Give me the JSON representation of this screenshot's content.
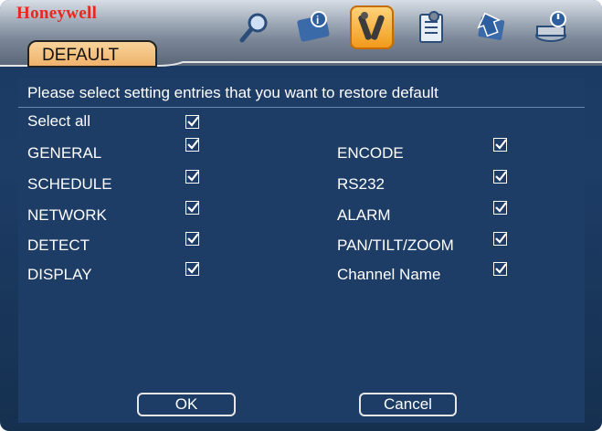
{
  "header": {
    "brand": "Honeywell",
    "tab_label": "DEFAULT",
    "icons": [
      {
        "name": "search-icon",
        "active": false,
        "glyph": "🔍"
      },
      {
        "name": "info-icon",
        "active": false,
        "glyph": "📘"
      },
      {
        "name": "tools-icon",
        "active": true,
        "glyph": "🛠"
      },
      {
        "name": "checklist-icon",
        "active": false,
        "glyph": "📋"
      },
      {
        "name": "download-icon",
        "active": false,
        "glyph": "⬇"
      },
      {
        "name": "shutdown-icon",
        "active": false,
        "glyph": "⏻"
      }
    ]
  },
  "main": {
    "prompt": "Please select setting entries that you want to restore default",
    "select_all": {
      "label": "Select all",
      "checked": true
    },
    "left_items": [
      {
        "label": "GENERAL",
        "checked": true
      },
      {
        "label": "SCHEDULE",
        "checked": true
      },
      {
        "label": "NETWORK",
        "checked": true
      },
      {
        "label": "DETECT",
        "checked": true
      },
      {
        "label": "DISPLAY",
        "checked": true
      }
    ],
    "right_items": [
      {
        "label": "ENCODE",
        "checked": true
      },
      {
        "label": "RS232",
        "checked": true
      },
      {
        "label": "ALARM",
        "checked": true
      },
      {
        "label": "PAN/TILT/ZOOM",
        "checked": true
      },
      {
        "label": "Channel Name",
        "checked": true
      }
    ]
  },
  "buttons": {
    "ok": "OK",
    "cancel": "Cancel"
  }
}
